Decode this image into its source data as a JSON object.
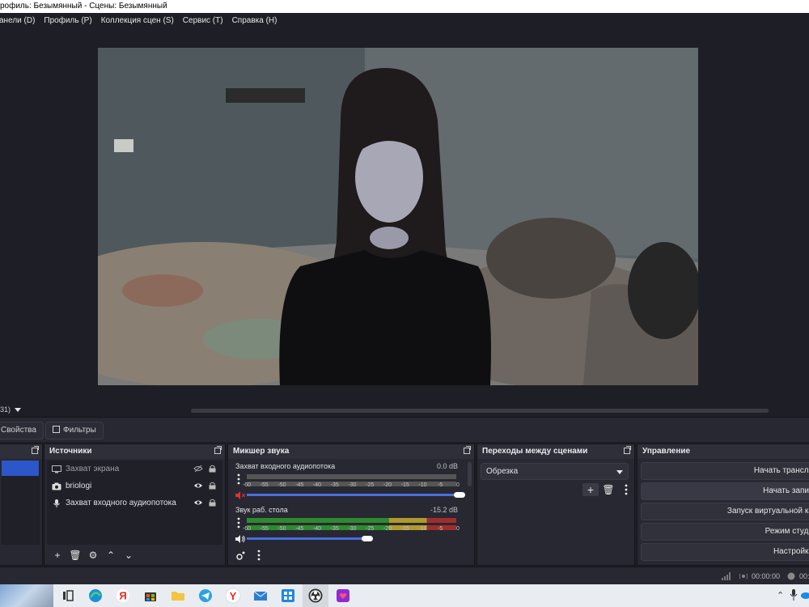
{
  "window": {
    "title": "рофиль: Безымянный - Сцены: Безымянный"
  },
  "menu": [
    {
      "label": "анели (D)"
    },
    {
      "label": "Профиль (P)"
    },
    {
      "label": "Коллекция сцен (S)"
    },
    {
      "label": "Сервис (T)"
    },
    {
      "label": "Справка (H)"
    }
  ],
  "preview": {
    "scale_label": "31)"
  },
  "context": {
    "properties_label": "Свойства",
    "filters_label": "Фильтры"
  },
  "sources": {
    "title": "Источники",
    "items": [
      {
        "name": "Захват экрана",
        "icon": "monitor-icon",
        "visible": false
      },
      {
        "name": "briologi",
        "icon": "camera-icon",
        "visible": true
      },
      {
        "name": "Захват входного аудиопотока",
        "icon": "microphone-icon",
        "visible": true
      }
    ]
  },
  "mixer": {
    "title": "Микшер звука",
    "ticks": [
      "-60",
      "-55",
      "-50",
      "-45",
      "-40",
      "-35",
      "-30",
      "-25",
      "-20",
      "-15",
      "-10",
      "-5",
      "0"
    ],
    "channels": [
      {
        "name": "Захват входного аудиопотока",
        "db": "0.0 dB",
        "muted": true,
        "volume_fraction": 1.0,
        "level_fraction": 0.0
      },
      {
        "name": "Звук раб. стола",
        "db": "-15.2 dB",
        "muted": false,
        "volume_fraction": 0.55,
        "level_fraction": 1.0
      }
    ]
  },
  "transitions": {
    "title": "Переходы между сценами",
    "selected": "Обрезка"
  },
  "controls": {
    "title": "Управление",
    "buttons": [
      {
        "label": "Начать трансля"
      },
      {
        "label": "Начать запис"
      },
      {
        "label": "Запуск виртуальной ка"
      },
      {
        "label": "Режим студи"
      },
      {
        "label": "Настройки"
      }
    ]
  },
  "status": {
    "stream_time": "00:00:00",
    "rec_time": "00:"
  },
  "colors": {
    "accent": "#2d56c9",
    "slider": "#4a6de0",
    "meter_green": "#2f8a2f",
    "meter_yellow": "#b09a2c",
    "meter_red": "#a02d2d"
  }
}
